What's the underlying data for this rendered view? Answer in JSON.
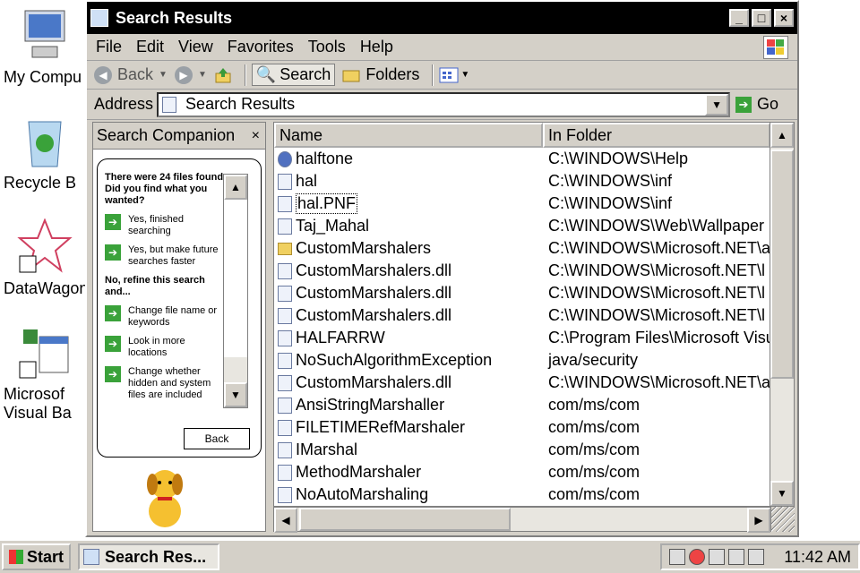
{
  "desktop": {
    "icons": [
      {
        "label": "My Compu",
        "icon": "my-computer-icon"
      },
      {
        "label": "Recycle B",
        "icon": "recycle-bin-icon"
      },
      {
        "label": "DataWagon",
        "icon": "datawagon-icon"
      },
      {
        "label": "Microsof",
        "label2": "Visual Ba",
        "icon": "visual-basic-icon"
      }
    ]
  },
  "window": {
    "title": "Search Results",
    "controls": {
      "minimize": "_",
      "maximize": "□",
      "close": "×"
    },
    "menu": [
      "File",
      "Edit",
      "View",
      "Favorites",
      "Tools",
      "Help"
    ],
    "toolbar": {
      "back": "Back",
      "search": "Search",
      "folders": "Folders"
    },
    "address": {
      "label": "Address",
      "value": "Search Results",
      "go": "Go"
    }
  },
  "companion": {
    "title": "Search Companion",
    "close": "×",
    "message": "There were 24 files found. Did you find what you wanted?",
    "options": [
      "Yes, finished searching",
      "Yes, but make future searches faster"
    ],
    "refine_heading": "No, refine this search and...",
    "refine_options": [
      "Change file name or keywords",
      "Look in more locations",
      "Change whether hidden and system files are included"
    ],
    "back": "Back"
  },
  "filelist": {
    "columns": [
      "Name",
      "In Folder"
    ],
    "rows": [
      {
        "name": "halftone",
        "folder": "C:\\WINDOWS\\Help",
        "icon": "help"
      },
      {
        "name": "hal",
        "folder": "C:\\WINDOWS\\inf",
        "icon": "file"
      },
      {
        "name": "hal.PNF",
        "folder": "C:\\WINDOWS\\inf",
        "icon": "file",
        "selected": true
      },
      {
        "name": "Taj_Mahal",
        "folder": "C:\\WINDOWS\\Web\\Wallpaper",
        "icon": "file"
      },
      {
        "name": "CustomMarshalers",
        "folder": "C:\\WINDOWS\\Microsoft.NET\\a",
        "icon": "folder"
      },
      {
        "name": "CustomMarshalers.dll",
        "folder": "C:\\WINDOWS\\Microsoft.NET\\l",
        "icon": "file"
      },
      {
        "name": "CustomMarshalers.dll",
        "folder": "C:\\WINDOWS\\Microsoft.NET\\l",
        "icon": "file"
      },
      {
        "name": "CustomMarshalers.dll",
        "folder": "C:\\WINDOWS\\Microsoft.NET\\l",
        "icon": "file"
      },
      {
        "name": "HALFARRW",
        "folder": "C:\\Program Files\\Microsoft Visu",
        "icon": "file"
      },
      {
        "name": "NoSuchAlgorithmException",
        "folder": "java/security",
        "icon": "file"
      },
      {
        "name": "CustomMarshalers.dll",
        "folder": "C:\\WINDOWS\\Microsoft.NET\\a",
        "icon": "file"
      },
      {
        "name": "AnsiStringMarshaller",
        "folder": "com/ms/com",
        "icon": "file"
      },
      {
        "name": "FILETIMERefMarshaler",
        "folder": "com/ms/com",
        "icon": "file"
      },
      {
        "name": "IMarshal",
        "folder": "com/ms/com",
        "icon": "file"
      },
      {
        "name": "MethodMarshaler",
        "folder": "com/ms/com",
        "icon": "file"
      },
      {
        "name": "NoAutoMarshaling",
        "folder": "com/ms/com",
        "icon": "file"
      }
    ]
  },
  "taskbar": {
    "start": "Start",
    "task": "Search Res...",
    "clock": "11:42 AM"
  }
}
